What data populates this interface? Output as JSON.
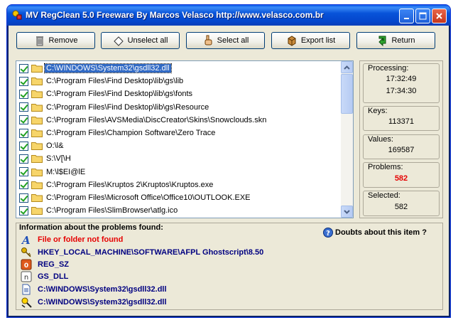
{
  "window": {
    "title": "MV RegClean 5.0 Freeware   By Marcos Velasco   http://www.velasco.com.br"
  },
  "toolbar": {
    "remove_label": "Remove",
    "unselect_all_label": "Unselect all",
    "select_all_label": "Select all",
    "export_list_label": "Export list",
    "return_label": "Return"
  },
  "list": {
    "items": [
      "C:\\WINDOWS\\System32\\gsdll32.dll",
      "C:\\Program Files\\Find Desktop\\lib\\gs\\lib",
      "C:\\Program Files\\Find Desktop\\lib\\gs\\fonts",
      "C:\\Program Files\\Find Desktop\\lib\\gs\\Resource",
      "C:\\Program Files\\AVSMedia\\DiscCreator\\Skins\\Snowclouds.skn",
      "C:\\Program Files\\Champion Software\\Zero Trace",
      "O:\\l&",
      "S:\\V[\\H",
      "M:\\l$EI@lE",
      "C:\\Program Files\\Kruptos 2\\Kruptos\\Kruptos.exe",
      "C:\\Program Files\\Microsoft Office\\Office10\\OUTLOOK.EXE",
      "C:\\Program Files\\SlimBrowser\\atlg.ico"
    ],
    "selected_index": 0
  },
  "stats": {
    "processing_label": "Processing:",
    "processing_start": "17:32:49",
    "processing_end": "17:34:30",
    "keys_label": "Keys:",
    "keys_value": "113371",
    "values_label": "Values:",
    "values_value": "169587",
    "problems_label": "Problems:",
    "problems_value": "582",
    "selected_label": "Selected:",
    "selected_value": "582"
  },
  "info": {
    "title": "Information about the problems found:",
    "doubts_label": "Doubts about this item ?",
    "problem_type": "File or folder not found",
    "registry_key": "HKEY_LOCAL_MACHINE\\SOFTWARE\\AFPL Ghostscript\\8.50",
    "value_type": "REG_SZ",
    "value_name": "GS_DLL",
    "value_data": "C:\\WINDOWS\\System32\\gsdll32.dll",
    "missing_path": "C:\\WINDOWS\\System32\\gsdll32.dll"
  },
  "colors": {
    "titlebar": "#0853d9",
    "selection": "#316ac5",
    "problems_value": "#e60000",
    "info_text": "#000080",
    "info_problem": "#e60000"
  },
  "icons": {
    "title": "app-icon",
    "remove": "trash-icon",
    "unselect_all": "eraser-icon",
    "select_all": "hand-pointer-icon",
    "export_list": "export-icon",
    "return": "return-arrow-icon",
    "doubts": "help-icon"
  }
}
